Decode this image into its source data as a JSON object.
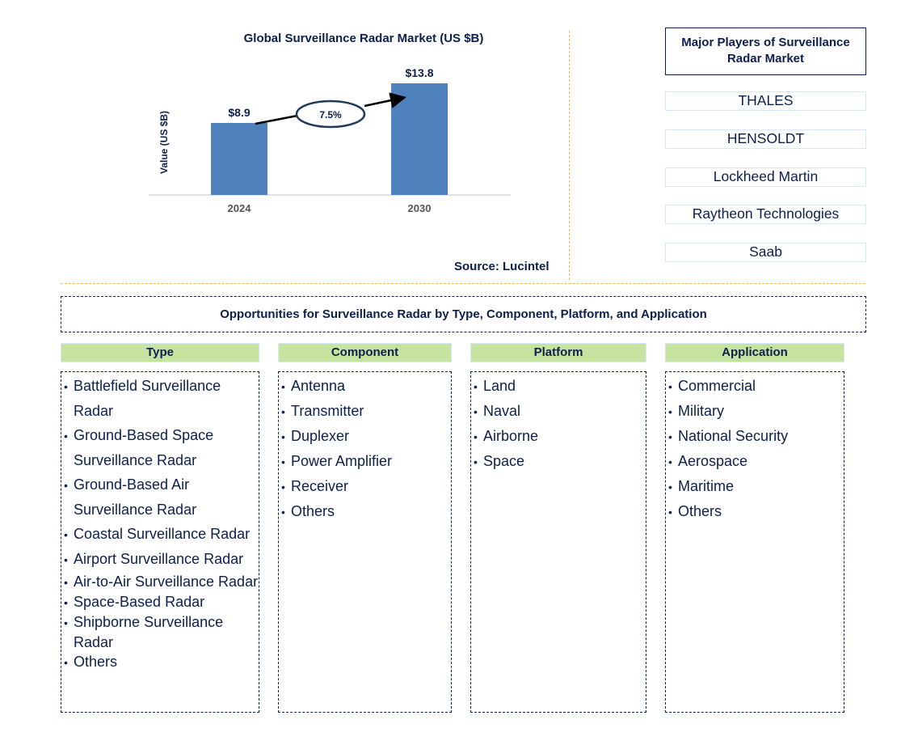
{
  "chart_data": {
    "type": "bar",
    "title": "Global Surveillance Radar Market (US $B)",
    "xlabel": "",
    "ylabel": "Value (US $B)",
    "categories": [
      "2024",
      "2030"
    ],
    "values": [
      8.9,
      13.8
    ],
    "data_labels": [
      "$8.9",
      "$13.8"
    ],
    "ylim": [
      0,
      16
    ],
    "grid": false,
    "bar_color": "#4f81bd",
    "annotation": {
      "type": "cagr-arrow",
      "label": "7.5%",
      "from": "2024",
      "to": "2030"
    }
  },
  "source": "Source: Lucintel",
  "players": {
    "title": "Major Players of Surveillance Radar Market",
    "items": [
      "THALES",
      "HENSOLDT",
      "Lockheed Martin",
      "Raytheon Technologies",
      "Saab"
    ]
  },
  "opportunities": {
    "title": "Opportunities for Surveillance Radar by Type, Component, Platform, and Application",
    "columns": [
      {
        "heading": "Type",
        "items": [
          "Battlefield Surveillance Radar",
          "Ground-Based Space Surveillance Radar",
          "Ground-Based Air Surveillance Radar",
          "Coastal Surveillance Radar",
          "Airport Surveillance Radar",
          "Air-to-Air Surveillance Radar",
          "Space-Based Radar",
          "Shipborne Surveillance Radar",
          "Others"
        ]
      },
      {
        "heading": "Component",
        "items": [
          "Antenna",
          "Transmitter",
          "Duplexer",
          "Power Amplifier",
          "Receiver",
          "Others"
        ]
      },
      {
        "heading": "Platform",
        "items": [
          "Land",
          "Naval",
          "Airborne",
          "Space"
        ]
      },
      {
        "heading": "Application",
        "items": [
          "Commercial",
          "Military",
          "National Security",
          "Aerospace",
          "Maritime",
          "Others"
        ]
      }
    ]
  },
  "colors": {
    "text": "#0d1f4e",
    "bar": "#4f81bd",
    "divider": "#f4b844",
    "header_fill": "#c6e3a0"
  }
}
